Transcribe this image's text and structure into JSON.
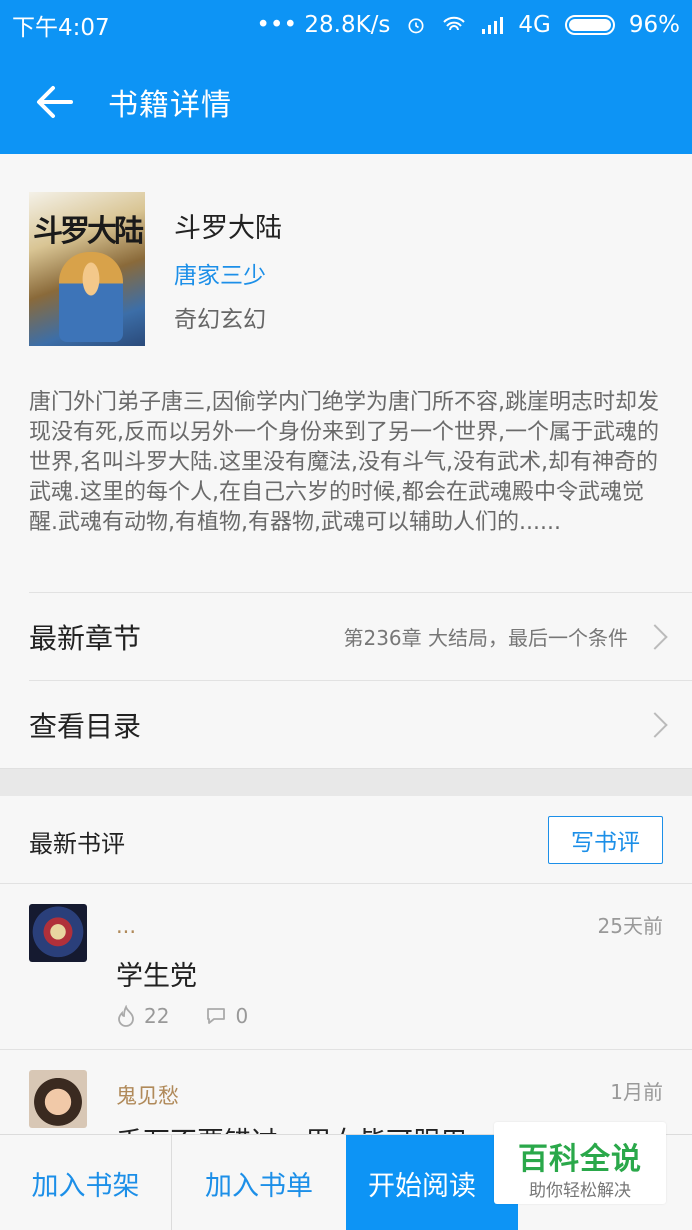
{
  "status_bar": {
    "time": "下午4:07",
    "speed": "••• 28.8K/s",
    "network": "4G",
    "battery": "96%"
  },
  "header": {
    "title": "书籍详情",
    "back_icon": "arrow-left-icon"
  },
  "book": {
    "name": "斗罗大陆",
    "author": "唐家三少",
    "category": "奇幻玄幻",
    "cover_title": "斗罗大陆",
    "description": "唐门外门弟子唐三,因偷学内门绝学为唐门所不容,跳崖明志时却发现没有死,反而以另外一个身份来到了另一个世界,一个属于武魂的世界,名叫斗罗大陆.这里没有魔法,没有斗气,没有武术,却有神奇的武魂.这里的每个人,在自己六岁的时候,都会在武魂殿中令武魂觉醒.武魂有动物,有植物,有器物,武魂可以辅助人们的......"
  },
  "rows": {
    "latest_label": "最新章节",
    "latest_value": "第236章 大结局，最后一个条件",
    "toc_label": "查看目录"
  },
  "reviews": {
    "title": "最新书评",
    "write_button": "写书评",
    "items": [
      {
        "user": "...",
        "time": "25天前",
        "text": "学生党",
        "likes": "22",
        "comments": "0"
      },
      {
        "user": "鬼见愁",
        "time": "1月前",
        "text": "千万不要错过，男女皆可服用"
      }
    ]
  },
  "bottom_bar": {
    "add_shelf": "加入书架",
    "add_list": "加入书单",
    "start_read": "开始阅读"
  },
  "watermark": {
    "main": "百科全说",
    "sub": "助你轻松解决"
  },
  "colors": {
    "primary": "#0d94f5",
    "link": "#1c8fe8",
    "username": "#b08a5a",
    "watermark": "#2aa84a"
  }
}
